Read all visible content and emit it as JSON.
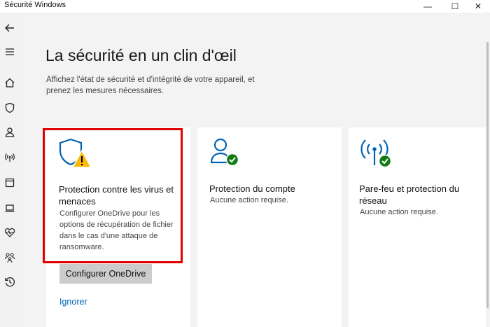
{
  "window": {
    "title": "Sécurité Windows",
    "controls": {
      "minimize": "—",
      "maximize": "☐",
      "close": "✕"
    }
  },
  "sidebar": {
    "items": [
      {
        "name": "back",
        "icon": "back-arrow-icon"
      },
      {
        "name": "menu",
        "icon": "hamburger-menu-icon"
      },
      {
        "name": "home",
        "icon": "home-icon"
      },
      {
        "name": "virus-protection",
        "icon": "shield-icon"
      },
      {
        "name": "account-protection",
        "icon": "person-icon"
      },
      {
        "name": "firewall",
        "icon": "wifi-antenna-icon"
      },
      {
        "name": "app-browser-control",
        "icon": "browser-window-icon"
      },
      {
        "name": "device-security",
        "icon": "laptop-icon"
      },
      {
        "name": "device-performance",
        "icon": "heart-pulse-icon"
      },
      {
        "name": "family-options",
        "icon": "family-icon"
      },
      {
        "name": "protection-history",
        "icon": "history-icon"
      }
    ]
  },
  "main": {
    "title": "La sécurité en un clin d'œil",
    "subtitle": "Affichez l'état de sécurité et d'intégrité de votre appareil, et prenez les mesures nécessaires.",
    "cards": [
      {
        "title": "Protection contre les virus et menaces",
        "description": "Configurer OneDrive pour les options de récupération de fichier dans le cas d'une attaque de ransomware.",
        "button_label": "Configurer OneDrive",
        "link_label": "Ignorer",
        "status": "warning"
      },
      {
        "title": "Protection du compte",
        "description": "Aucune action requise.",
        "status": "ok"
      },
      {
        "title": "Pare-feu et protection du réseau",
        "description": "Aucune action requise.",
        "status": "ok"
      }
    ]
  },
  "colors": {
    "accent_blue": "#0063b1",
    "ok_green": "#107c10",
    "warning_yellow": "#ffb900",
    "highlight_red": "#e00000"
  }
}
